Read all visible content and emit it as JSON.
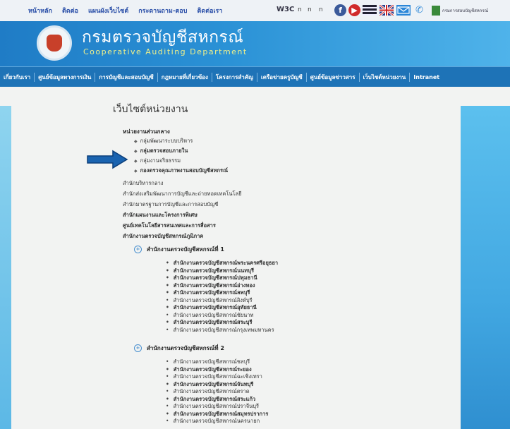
{
  "top_nav": {
    "items": [
      "หน้าหลัก",
      "ติดต่อ",
      "แผนผังเว็บไซต์",
      "กระดานถาม-ตอบ",
      "ติดต่อเรา"
    ],
    "w3c": "W3C",
    "marks": [
      "n",
      "n",
      "n"
    ],
    "org_link": "กรมการสอบบัญชีสหกรณ์"
  },
  "header": {
    "title": "กรมตรวจบัญชีสหกรณ์",
    "subtitle": "Cooperative Auditing Department"
  },
  "main_nav": {
    "items": [
      "เกี่ยวกับเรา",
      "ศูนย์ข้อมูลทางการเงิน",
      "การบัญชีและสอบบัญชี",
      "กฎหมายที่เกี่ยวข้อง",
      "โครงการสำคัญ",
      "เครือข่ายครูบัญชี",
      "ศูนย์ข้อมูลข่าวสาร",
      "เว็บไซต์หน่วยงาน",
      "Intranet"
    ]
  },
  "page": {
    "title": "เว็บไซต์หน่วยงาน",
    "central_heading": "หน่วยงานส่วนกลาง",
    "central_units": [
      {
        "label": "กลุ่มพัฒนาระบบบริหาร",
        "bold": false
      },
      {
        "label": "กลุ่มตรวจสอบภายใน",
        "bold": true
      },
      {
        "label": "กลุ่มงานจริยธรรม",
        "bold": false
      },
      {
        "label": "กองตรวจคุณภาพงานสอบบัญชีสหกรณ์",
        "bold": true
      }
    ],
    "offices": [
      {
        "label": "สำนักบริหารกลาง",
        "bold": false
      },
      {
        "label": "สำนักส่งเสริมพัฒนาการบัญชีและถ่ายทอดเทคโนโลยี",
        "bold": false
      },
      {
        "label": "สำนักมาตรฐานการบัญชีและการสอบบัญชี",
        "bold": false
      },
      {
        "label": "สำนักแผนงานและโครงการพิเศษ",
        "bold": true
      },
      {
        "label": "ศูนย์เทคโนโลยีสารสนเทศและการสื่อสาร",
        "bold": true
      },
      {
        "label": "สำนักงานตรวจบัญชีสหกรณ์ภูมิภาค",
        "bold": true
      }
    ],
    "region1": {
      "heading": "สำนักงานตรวจบัญชีสหกรณ์ที่ 1",
      "items": [
        {
          "label": "สำนักงานตรวจบัญชีสหกรณ์พระนครศรีอยุธยา",
          "bold": true
        },
        {
          "label": "สำนักงานตรวจบัญชีสหกรณ์นนทบุรี",
          "bold": true
        },
        {
          "label": "สำนักงานตรวจบัญชีสหกรณ์ปทุมธานี",
          "bold": true
        },
        {
          "label": "สำนักงานตรวจบัญชีสหกรณ์อ่างทอง",
          "bold": true
        },
        {
          "label": "สำนักงานตรวจบัญชีสหกรณ์ลพบุรี",
          "bold": true
        },
        {
          "label": "สำนักงานตรวจบัญชีสหกรณ์สิงห์บุรี",
          "bold": false
        },
        {
          "label": "สำนักงานตรวจบัญชีสหกรณ์อุทัยธานี",
          "bold": true
        },
        {
          "label": "สำนักงานตรวจบัญชีสหกรณ์ชัยนาท",
          "bold": false
        },
        {
          "label": "สำนักงานตรวจบัญชีสหกรณ์สระบุรี",
          "bold": true
        },
        {
          "label": "สำนักงานตรวจบัญชีสหกรณ์กรุงเทพมหานคร",
          "bold": false
        }
      ]
    },
    "region2": {
      "heading": "สำนักงานตรวจบัญชีสหกรณ์ที่ 2",
      "items": [
        {
          "label": "สำนักงานตรวจบัญชีสหกรณ์ชลบุรี",
          "bold": false
        },
        {
          "label": "สำนักงานตรวจบัญชีสหกรณ์ระยอง",
          "bold": true
        },
        {
          "label": "สำนักงานตรวจบัญชีสหกรณ์ฉะเชิงเทรา",
          "bold": false
        },
        {
          "label": "สำนักงานตรวจบัญชีสหกรณ์จันทบุรี",
          "bold": true
        },
        {
          "label": "สำนักงานตรวจบัญชีสหกรณ์ตราด",
          "bold": false
        },
        {
          "label": "สำนักงานตรวจบัญชีสหกรณ์สระแก้ว",
          "bold": true
        },
        {
          "label": "สำนักงานตรวจบัญชีสหกรณ์ปราจีนบุรี",
          "bold": false
        },
        {
          "label": "สำนักงานตรวจบัญชีสหกรณ์สมุทรปราการ",
          "bold": true
        },
        {
          "label": "สำนักงานตรวจบัญชีสหกรณ์นครนายก",
          "bold": false
        }
      ]
    }
  },
  "colors": {
    "banner": "#2b92d6",
    "nav": "#1e73b7",
    "accent_text": "#f0f08a",
    "arrow_fill": "#1a63b0"
  },
  "icons": {
    "social": [
      "facebook-icon",
      "youtube-icon",
      "menu-icon",
      "uk-flag-icon",
      "email-icon",
      "phone-icon"
    ],
    "arrow": "right-arrow-icon"
  }
}
